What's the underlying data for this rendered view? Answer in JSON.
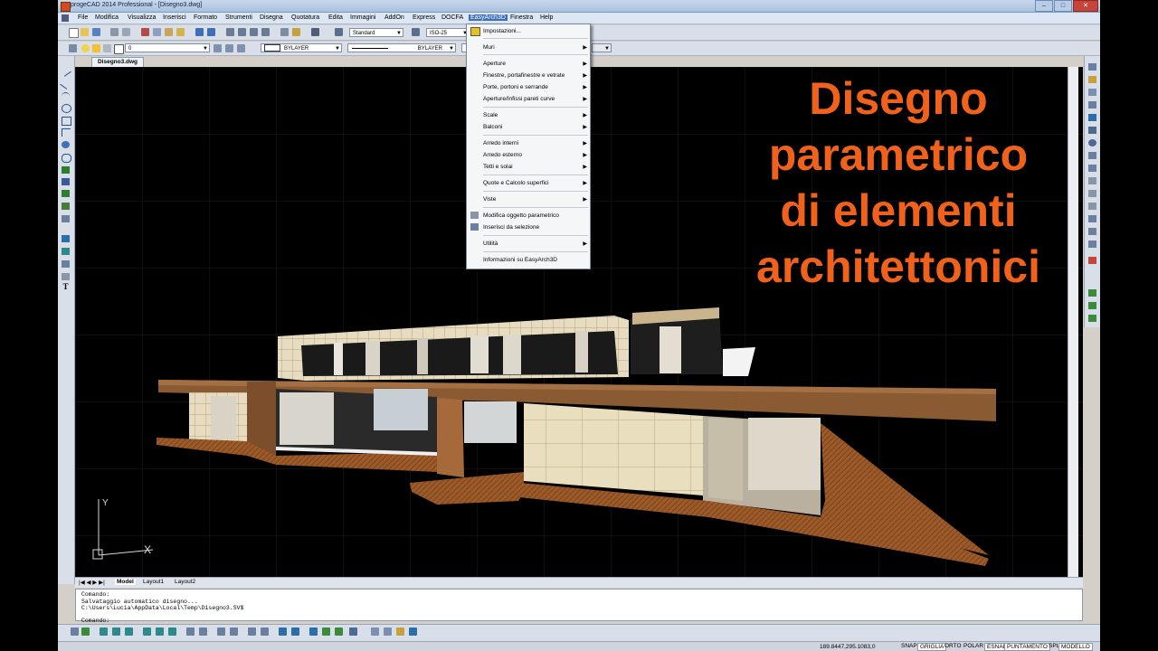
{
  "window": {
    "title": "progeCAD 2014 Professional - [Disegno3.dwg]",
    "buttons": [
      "–",
      "□",
      "✕"
    ]
  },
  "menubar": {
    "items": [
      {
        "label": "File"
      },
      {
        "label": "Modifica"
      },
      {
        "label": "Visualizza"
      },
      {
        "label": "Inserisci"
      },
      {
        "label": "Formato"
      },
      {
        "label": "Strumenti"
      },
      {
        "label": "Disegna"
      },
      {
        "label": "Quotatura"
      },
      {
        "label": "Edita"
      },
      {
        "label": "Immagini"
      },
      {
        "label": "AddOn"
      },
      {
        "label": "Express"
      },
      {
        "label": "DOCFA"
      },
      {
        "label": "EasyArch3D"
      },
      {
        "label": "Finestra"
      },
      {
        "label": "Help"
      }
    ]
  },
  "toolbar": {
    "text_style": "Standard",
    "dim_style": "ISO-25",
    "layer": "0",
    "color": "BYLAYER",
    "linetype": "BYLAYER"
  },
  "document_tab": "Disegno3.dwg",
  "dropdown": {
    "items": [
      {
        "label": "Impostazioni...",
        "submenu": false,
        "icon": "settings-icon"
      },
      {
        "label": "Muri",
        "submenu": true
      },
      {
        "label": "Aperture",
        "submenu": true
      },
      {
        "label": "Finestre, portafinestre e vetrate",
        "submenu": true
      },
      {
        "label": "Porte, portoni e serrande",
        "submenu": true
      },
      {
        "label": "Aperture/Infissi pareti curve",
        "submenu": true
      },
      {
        "label": "Scale",
        "submenu": true
      },
      {
        "label": "Balconi",
        "submenu": true
      },
      {
        "label": "Arredo interni",
        "submenu": true
      },
      {
        "label": "Arredo esterno",
        "submenu": true
      },
      {
        "label": "Tetti e solai",
        "submenu": true
      },
      {
        "label": "Quote e Calcolo superfici",
        "submenu": true
      },
      {
        "label": "Viste",
        "submenu": true
      },
      {
        "label": "Modifica oggetto parametrico",
        "submenu": false,
        "icon": "edit-parametric-icon"
      },
      {
        "label": "Inserisci da selezione",
        "submenu": false,
        "icon": "insert-selection-icon"
      },
      {
        "label": "Utilità",
        "submenu": true
      },
      {
        "label": "Informazioni su EasyArch3D",
        "submenu": false
      }
    ]
  },
  "overlay": {
    "lines": [
      "Disegno",
      "parametrico",
      "di elementi",
      "architettonici"
    ],
    "color": "#f0621c"
  },
  "layout_tabs": [
    "Model",
    "Layout1",
    "Layout2"
  ],
  "command": {
    "history": [
      "Comando:",
      "Salvataggio automatico disegno...",
      "C:\\Users\\Lucia\\AppData\\Local\\Temp\\Disegno3.SV$"
    ],
    "prompt": "Comando:"
  },
  "ucs": {
    "x_label": "X",
    "y_label": "Y"
  },
  "status": {
    "coords": "189.8447,295.1083,0",
    "toggles": [
      {
        "label": "SNAP",
        "on": false
      },
      {
        "label": "GRIGLIA",
        "on": true
      },
      {
        "label": "ORTO",
        "on": false
      },
      {
        "label": "POLAR",
        "on": false
      },
      {
        "label": "ESNAP",
        "on": true
      },
      {
        "label": "PUNTAMENTO",
        "on": true
      },
      {
        "label": "SPL",
        "on": false
      },
      {
        "label": "MODELLO",
        "on": true
      }
    ]
  }
}
